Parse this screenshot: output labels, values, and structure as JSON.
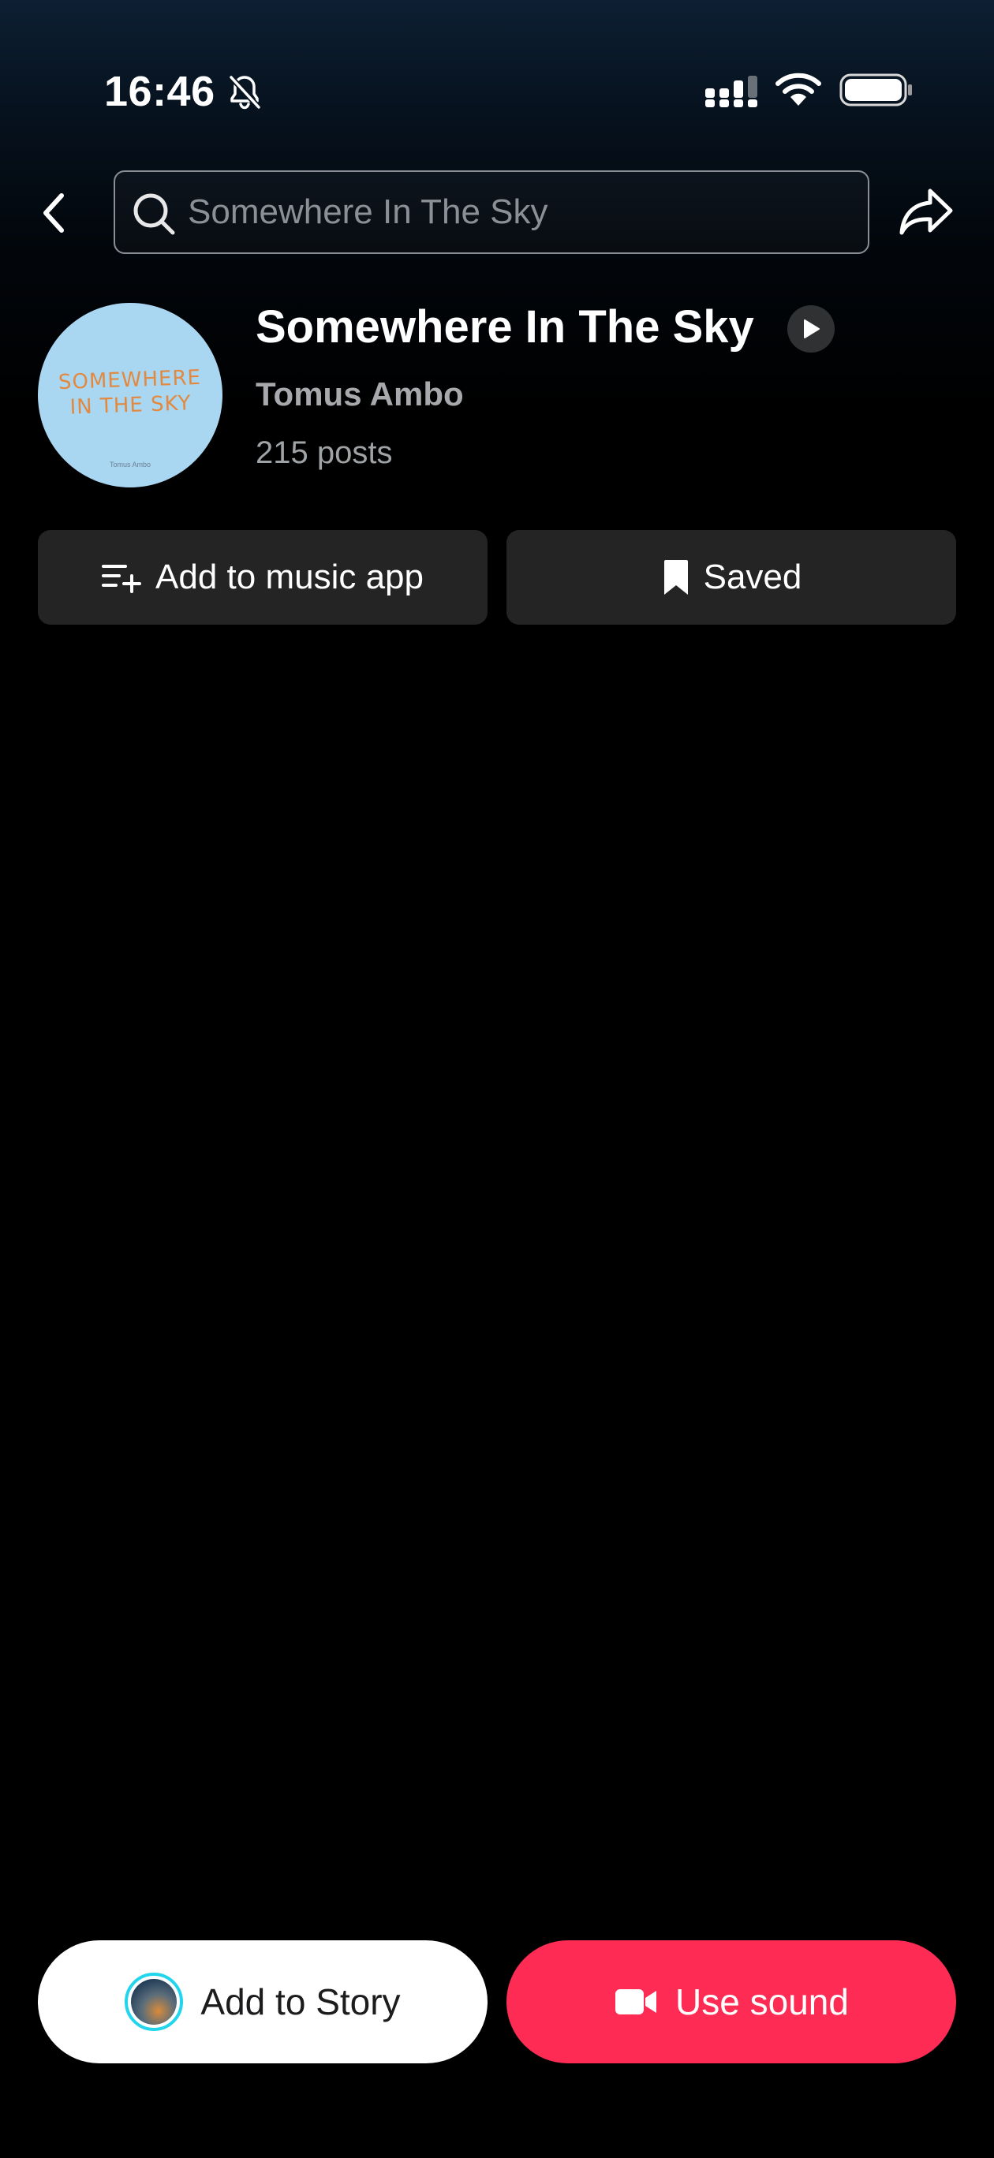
{
  "status_bar": {
    "time": "16:46",
    "icons": [
      "bell-muted-icon",
      "signal-icon",
      "wifi-icon",
      "battery-icon"
    ]
  },
  "header": {
    "back_icon": "chevron-left-icon",
    "search_placeholder": "Somewhere In The Sky",
    "share_icon": "share-arrow-icon"
  },
  "sound": {
    "cover_text": "SOMEWHERE\nIN THE SKY",
    "cover_footer": "Tomus Ambo",
    "title": "Somewhere In The Sky",
    "artist": "Tomus Ambo",
    "posts": "215 posts"
  },
  "actions": {
    "add_to_music_app": "Add to music app",
    "saved": "Saved"
  },
  "bottom_bar": {
    "add_to_story": "Add to Story",
    "use_sound": "Use sound"
  },
  "colors": {
    "accent": "#fe2c55",
    "story_ring": "#20d5ec",
    "button_dark": "#242424",
    "background": "#000000"
  }
}
